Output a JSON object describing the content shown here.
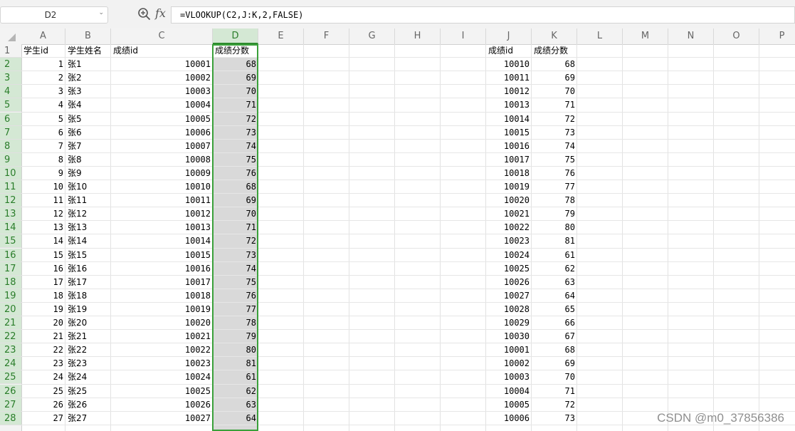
{
  "namebox": {
    "cell_ref": "D2"
  },
  "formula": {
    "text": "=VLOOKUP(C2,J:K,2,FALSE)"
  },
  "columns": [
    "A",
    "B",
    "C",
    "D",
    "E",
    "F",
    "G",
    "H",
    "I",
    "J",
    "K",
    "L",
    "M",
    "N",
    "O",
    "P"
  ],
  "active_column": "D",
  "row_numbers": [
    "1",
    "2",
    "3",
    "4",
    "5",
    "6",
    "7",
    "8",
    "9",
    "10",
    "11",
    "12",
    "13",
    "14",
    "15",
    "16",
    "17",
    "18",
    "19",
    "20",
    "21",
    "22",
    "23",
    "24",
    "25",
    "26",
    "27",
    "28"
  ],
  "headers": {
    "a": "学生id",
    "b": "学生姓名",
    "c": "成绩id",
    "d": "成绩分数",
    "j": "成绩id",
    "k": "成绩分数"
  },
  "rows": [
    {
      "a": "1",
      "b": "张1",
      "c": "10001",
      "d": "68",
      "j": "10010",
      "k": "68"
    },
    {
      "a": "2",
      "b": "张2",
      "c": "10002",
      "d": "69",
      "j": "10011",
      "k": "69"
    },
    {
      "a": "3",
      "b": "张3",
      "c": "10003",
      "d": "70",
      "j": "10012",
      "k": "70"
    },
    {
      "a": "4",
      "b": "张4",
      "c": "10004",
      "d": "71",
      "j": "10013",
      "k": "71"
    },
    {
      "a": "5",
      "b": "张5",
      "c": "10005",
      "d": "72",
      "j": "10014",
      "k": "72"
    },
    {
      "a": "6",
      "b": "张6",
      "c": "10006",
      "d": "73",
      "j": "10015",
      "k": "73"
    },
    {
      "a": "7",
      "b": "张7",
      "c": "10007",
      "d": "74",
      "j": "10016",
      "k": "74"
    },
    {
      "a": "8",
      "b": "张8",
      "c": "10008",
      "d": "75",
      "j": "10017",
      "k": "75"
    },
    {
      "a": "9",
      "b": "张9",
      "c": "10009",
      "d": "76",
      "j": "10018",
      "k": "76"
    },
    {
      "a": "10",
      "b": "张10",
      "c": "10010",
      "d": "68",
      "j": "10019",
      "k": "77"
    },
    {
      "a": "11",
      "b": "张11",
      "c": "10011",
      "d": "69",
      "j": "10020",
      "k": "78"
    },
    {
      "a": "12",
      "b": "张12",
      "c": "10012",
      "d": "70",
      "j": "10021",
      "k": "79"
    },
    {
      "a": "13",
      "b": "张13",
      "c": "10013",
      "d": "71",
      "j": "10022",
      "k": "80"
    },
    {
      "a": "14",
      "b": "张14",
      "c": "10014",
      "d": "72",
      "j": "10023",
      "k": "81"
    },
    {
      "a": "15",
      "b": "张15",
      "c": "10015",
      "d": "73",
      "j": "10024",
      "k": "61"
    },
    {
      "a": "16",
      "b": "张16",
      "c": "10016",
      "d": "74",
      "j": "10025",
      "k": "62"
    },
    {
      "a": "17",
      "b": "张17",
      "c": "10017",
      "d": "75",
      "j": "10026",
      "k": "63"
    },
    {
      "a": "18",
      "b": "张18",
      "c": "10018",
      "d": "76",
      "j": "10027",
      "k": "64"
    },
    {
      "a": "19",
      "b": "张19",
      "c": "10019",
      "d": "77",
      "j": "10028",
      "k": "65"
    },
    {
      "a": "20",
      "b": "张20",
      "c": "10020",
      "d": "78",
      "j": "10029",
      "k": "66"
    },
    {
      "a": "21",
      "b": "张21",
      "c": "10021",
      "d": "79",
      "j": "10030",
      "k": "67"
    },
    {
      "a": "22",
      "b": "张22",
      "c": "10022",
      "d": "80",
      "j": "10001",
      "k": "68"
    },
    {
      "a": "23",
      "b": "张23",
      "c": "10023",
      "d": "81",
      "j": "10002",
      "k": "69"
    },
    {
      "a": "24",
      "b": "张24",
      "c": "10024",
      "d": "61",
      "j": "10003",
      "k": "70"
    },
    {
      "a": "25",
      "b": "张25",
      "c": "10025",
      "d": "62",
      "j": "10004",
      "k": "71"
    },
    {
      "a": "26",
      "b": "张26",
      "c": "10026",
      "d": "63",
      "j": "10005",
      "k": "72"
    },
    {
      "a": "27",
      "b": "张27",
      "c": "10027",
      "d": "64",
      "j": "10006",
      "k": "73"
    }
  ],
  "watermark": "CSDN @m0_37856386",
  "colors": {
    "selection_border": "#3aa03a",
    "selection_fill": "#d9d9d9",
    "header_bg": "#f3f3f3"
  }
}
